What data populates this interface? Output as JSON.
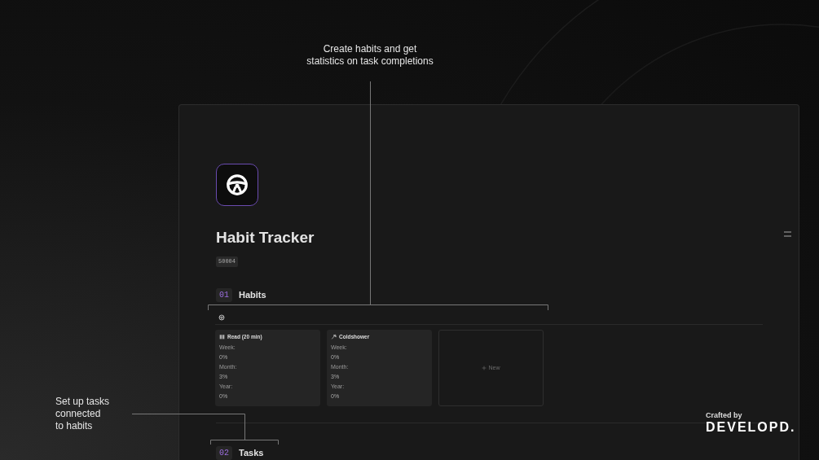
{
  "annotations": [
    {
      "lines": [
        "Create habits and get",
        "statistics on task completions"
      ]
    },
    {
      "lines": [
        "Set up tasks",
        "connected",
        "to habits"
      ]
    }
  ],
  "page": {
    "title": "Habit Tracker",
    "tag": "50004",
    "sections": [
      {
        "number": "01",
        "title": "Habits",
        "gallery": {
          "cards": [
            {
              "name": "Read (20 min)",
              "stats": [
                {
                  "label": "Week:",
                  "value": "0%"
                },
                {
                  "label": "Month:",
                  "value": "3%"
                },
                {
                  "label": "Year:",
                  "value": "0%"
                }
              ]
            },
            {
              "name": "Coldshower",
              "stats": [
                {
                  "label": "Week:",
                  "value": "0%"
                },
                {
                  "label": "Month:",
                  "value": "3%"
                },
                {
                  "label": "Year:",
                  "value": "0%"
                }
              ]
            }
          ],
          "new_label": "New"
        }
      },
      {
        "number": "02",
        "title": "Tasks"
      }
    ]
  },
  "credit": {
    "caption": "Crafted by",
    "brand": "DEVELOPD."
  }
}
